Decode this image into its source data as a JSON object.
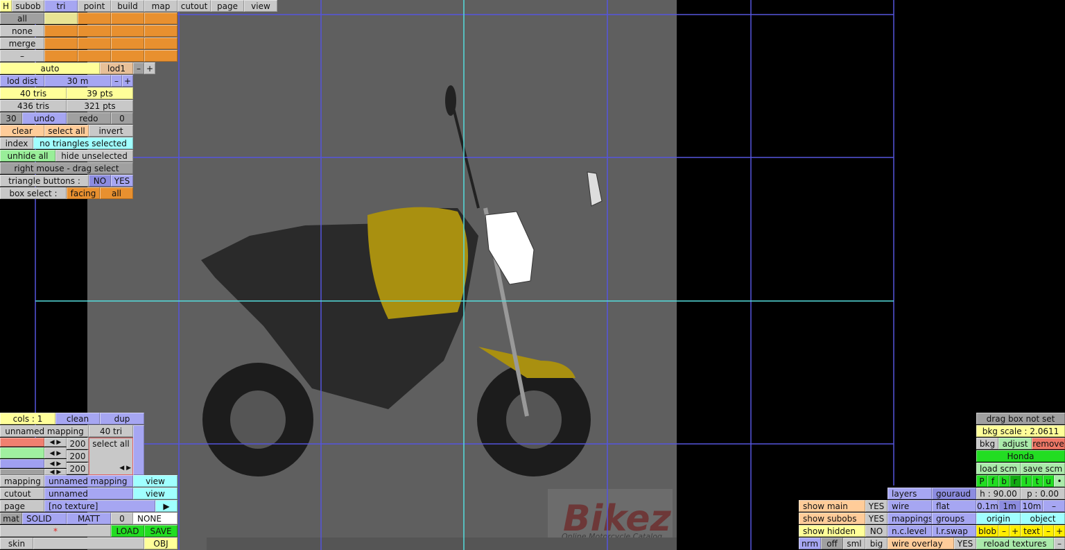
{
  "top_tabs": [
    "H",
    "subob",
    "tri",
    "point",
    "build",
    "map",
    "cutout",
    "page",
    "view"
  ],
  "select_rows": [
    "all",
    "none",
    "merge",
    "–"
  ],
  "lod": {
    "auto": "auto",
    "level": "lod1",
    "minus": "–",
    "plus": "+"
  },
  "lod_dist": {
    "label": "lod dist",
    "value": "30 m",
    "minus": "–",
    "plus": "+"
  },
  "counts": {
    "sel_tris": "40 tris",
    "sel_pts": "39 pts",
    "total_tris": "436 tris",
    "total_pts": "321 pts"
  },
  "history": {
    "undo_count": "30",
    "undo": "undo",
    "redo": "redo",
    "redo_count": "0"
  },
  "selection": {
    "clear": "clear",
    "select_all": "select all",
    "invert": "invert",
    "index": "index",
    "status": "no triangles selected",
    "unhide_all": "unhide all",
    "hide_unselected": "hide unselected",
    "right_mouse": "right mouse - drag select",
    "tri_buttons_label": "triangle buttons :",
    "no": "NO",
    "yes": "YES",
    "box_select_label": "box select :",
    "facing": "facing",
    "all": "all"
  },
  "mapping_panel": {
    "cols": "cols : 1",
    "clean": "clean",
    "dup": "dup",
    "mapping_name": "unnamed mapping",
    "tri_count": "40 tri",
    "slider_values": [
      "200",
      "200",
      "200"
    ],
    "select_all": "select all",
    "mapping_label": "mapping",
    "mapping_value": "unnamed mapping",
    "view": "view",
    "cutout_label": "cutout",
    "cutout_value": "unnamed",
    "page_label": "page",
    "page_value": "[no texture]",
    "page_arrow": "▶",
    "mat_label": "mat",
    "mat_type": "SOLID",
    "mat_finish": "MATT",
    "mat_num": "0",
    "mat_none": "NONE",
    "star": "*",
    "load": "LOAD",
    "save": "SAVE",
    "skin": "skin",
    "obj": "OBJ"
  },
  "bg_panel": {
    "drag_box": "drag box not set",
    "bkg_scale": "bkg scale : 2.0611",
    "bkg": "bkg",
    "adjust": "adjust",
    "remove": "remove",
    "name": "Honda",
    "load_scm": "load scm",
    "save_scm": "save scm",
    "views": [
      "P",
      "f",
      "b",
      "r",
      "l",
      "t",
      "u",
      "•"
    ],
    "h": "h : 90.00",
    "p": "p : 0.00",
    "steps": [
      "0.1m",
      "1m",
      "10m",
      "–"
    ],
    "origin": "origin",
    "object": "object",
    "blob": "blob",
    "text": "text",
    "minus": "–",
    "plus": "+",
    "reload": "reload textures"
  },
  "display_panel": {
    "show_main": "show main",
    "show_subobs": "show subobs",
    "show_hidden": "show hidden",
    "show_main_val": "YES",
    "show_subobs_val": "YES",
    "show_hidden_val": "NO",
    "modes": [
      "layers",
      "gouraud",
      "wire",
      "flat",
      "mappings",
      "groups",
      "n.c.level",
      "l.r.swap"
    ],
    "sizes": [
      "nrm",
      "off",
      "sml",
      "big"
    ],
    "wire_overlay": "wire overlay",
    "wire_overlay_val": "YES"
  },
  "watermark": {
    "brand": "Bikez",
    "tagline": "Online Motorcycle Catalog"
  },
  "colors": {
    "grid": "#5555dd",
    "axis": "#55dddd",
    "image_bg": "#5f5f5f"
  }
}
